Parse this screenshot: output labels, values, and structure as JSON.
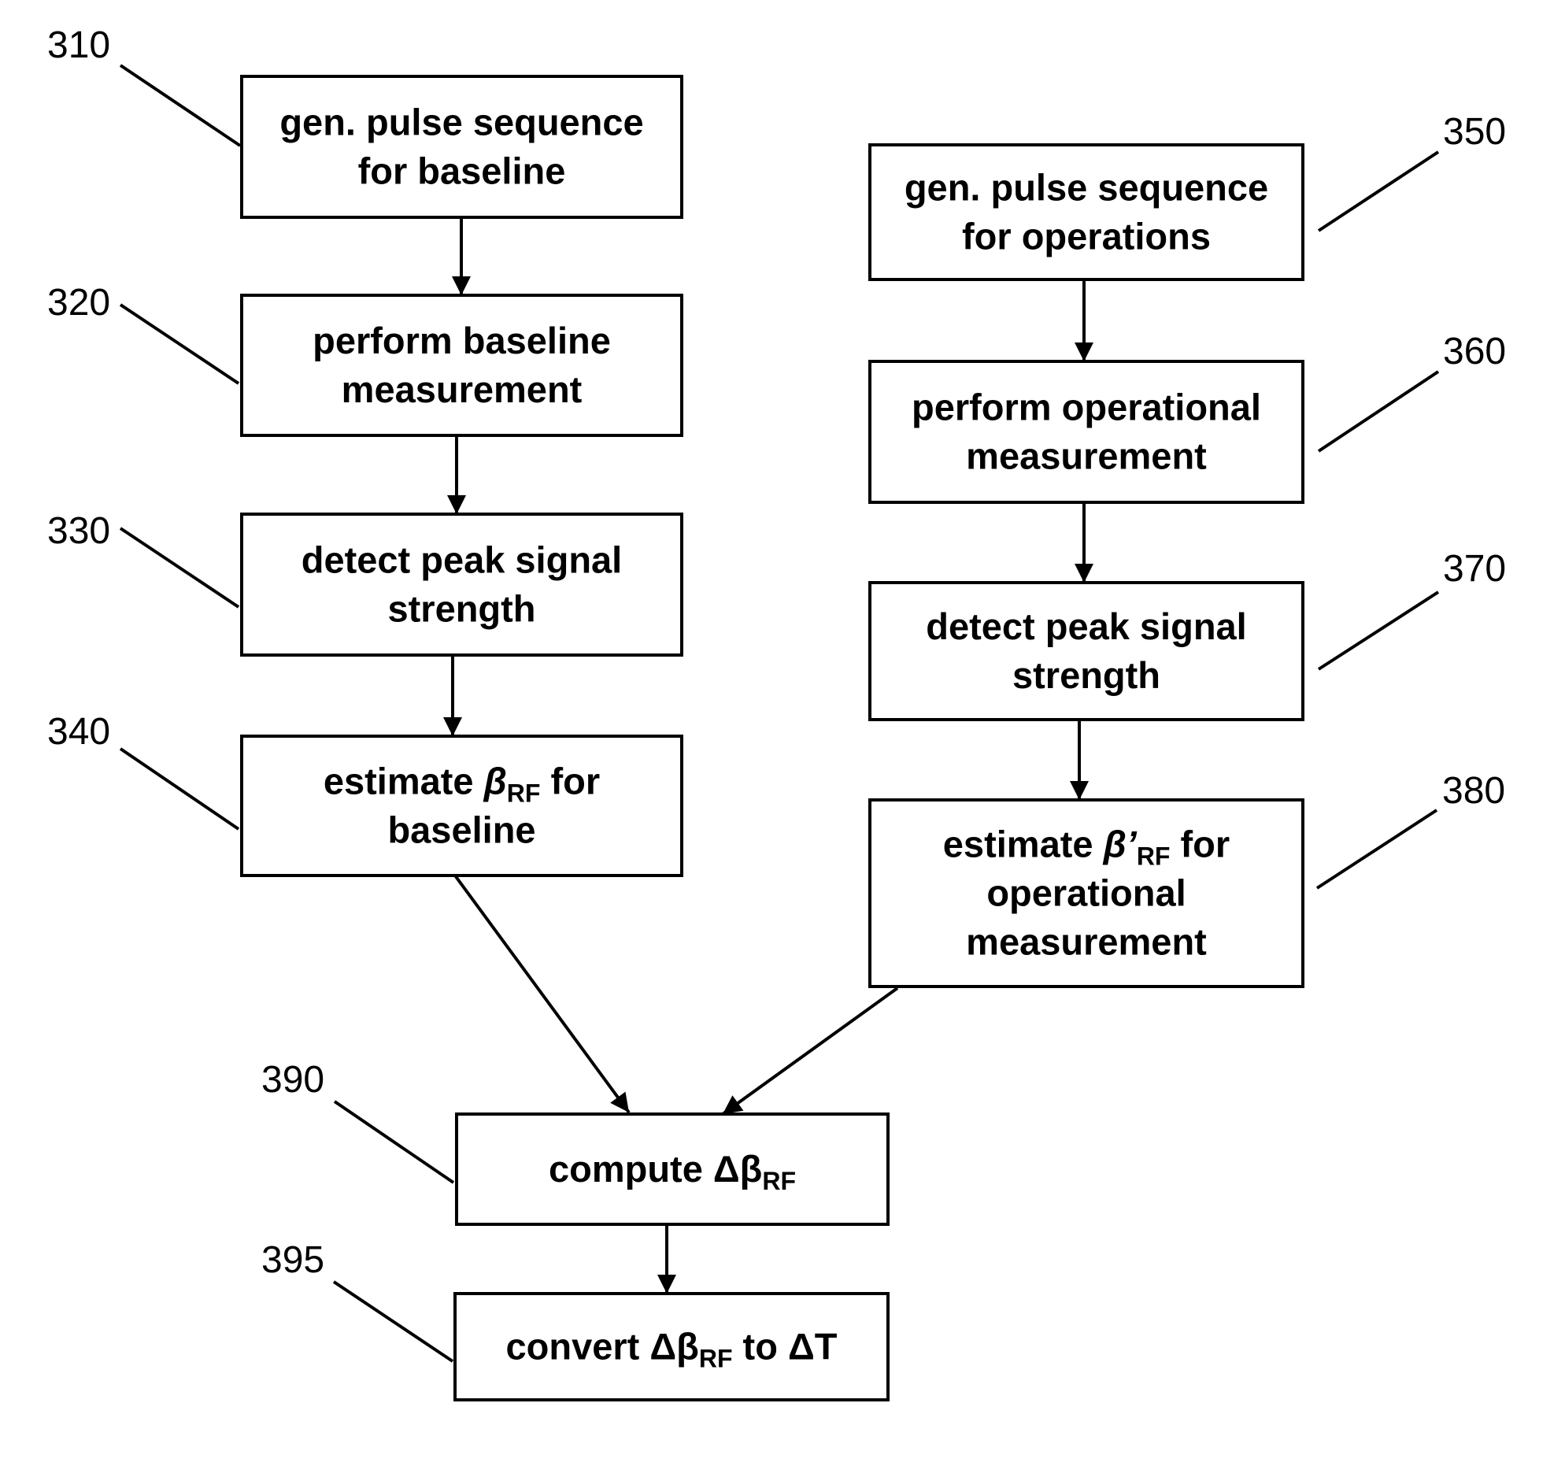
{
  "diagram": {
    "type": "flowchart",
    "colors": {
      "stroke": "#000000",
      "background": "#ffffff",
      "text": "#000000"
    },
    "steps": [
      {
        "id": "310",
        "ref": "310",
        "lines": [
          [
            {
              "t": "gen. pulse sequence"
            }
          ],
          [
            {
              "t": "for baseline"
            }
          ]
        ]
      },
      {
        "id": "320",
        "ref": "320",
        "lines": [
          [
            {
              "t": "perform baseline"
            }
          ],
          [
            {
              "t": "measurement"
            }
          ]
        ]
      },
      {
        "id": "330",
        "ref": "330",
        "lines": [
          [
            {
              "t": "detect peak signal"
            }
          ],
          [
            {
              "t": "strength"
            }
          ]
        ]
      },
      {
        "id": "340",
        "ref": "340",
        "lines": [
          [
            {
              "t": "estimate "
            },
            {
              "t": "β",
              "i": true
            },
            {
              "t": "RF",
              "s": true
            },
            {
              "t": " for"
            }
          ],
          [
            {
              "t": "baseline"
            }
          ]
        ]
      },
      {
        "id": "350",
        "ref": "350",
        "lines": [
          [
            {
              "t": "gen. pulse sequence"
            }
          ],
          [
            {
              "t": "for operations"
            }
          ]
        ]
      },
      {
        "id": "360",
        "ref": "360",
        "lines": [
          [
            {
              "t": "perform operational"
            }
          ],
          [
            {
              "t": "measurement"
            }
          ]
        ]
      },
      {
        "id": "370",
        "ref": "370",
        "lines": [
          [
            {
              "t": "detect peak signal"
            }
          ],
          [
            {
              "t": "strength"
            }
          ]
        ]
      },
      {
        "id": "380",
        "ref": "380",
        "lines": [
          [
            {
              "t": "estimate "
            },
            {
              "t": "β’",
              "i": true
            },
            {
              "t": "RF",
              "s": true
            },
            {
              "t": " for"
            }
          ],
          [
            {
              "t": "operational"
            }
          ],
          [
            {
              "t": "measurement"
            }
          ]
        ]
      },
      {
        "id": "390",
        "ref": "390",
        "lines": [
          [
            {
              "t": "compute Δβ"
            },
            {
              "t": "RF",
              "s": true
            }
          ]
        ]
      },
      {
        "id": "395",
        "ref": "395",
        "lines": [
          [
            {
              "t": "convert Δβ"
            },
            {
              "t": "RF",
              "s": true
            },
            {
              "t": " to ΔT"
            }
          ]
        ]
      }
    ],
    "edges": [
      {
        "from": "310",
        "to": "320"
      },
      {
        "from": "320",
        "to": "330"
      },
      {
        "from": "330",
        "to": "340"
      },
      {
        "from": "340",
        "to": "390"
      },
      {
        "from": "350",
        "to": "360"
      },
      {
        "from": "360",
        "to": "370"
      },
      {
        "from": "370",
        "to": "380"
      },
      {
        "from": "380",
        "to": "390"
      },
      {
        "from": "390",
        "to": "395"
      }
    ]
  }
}
